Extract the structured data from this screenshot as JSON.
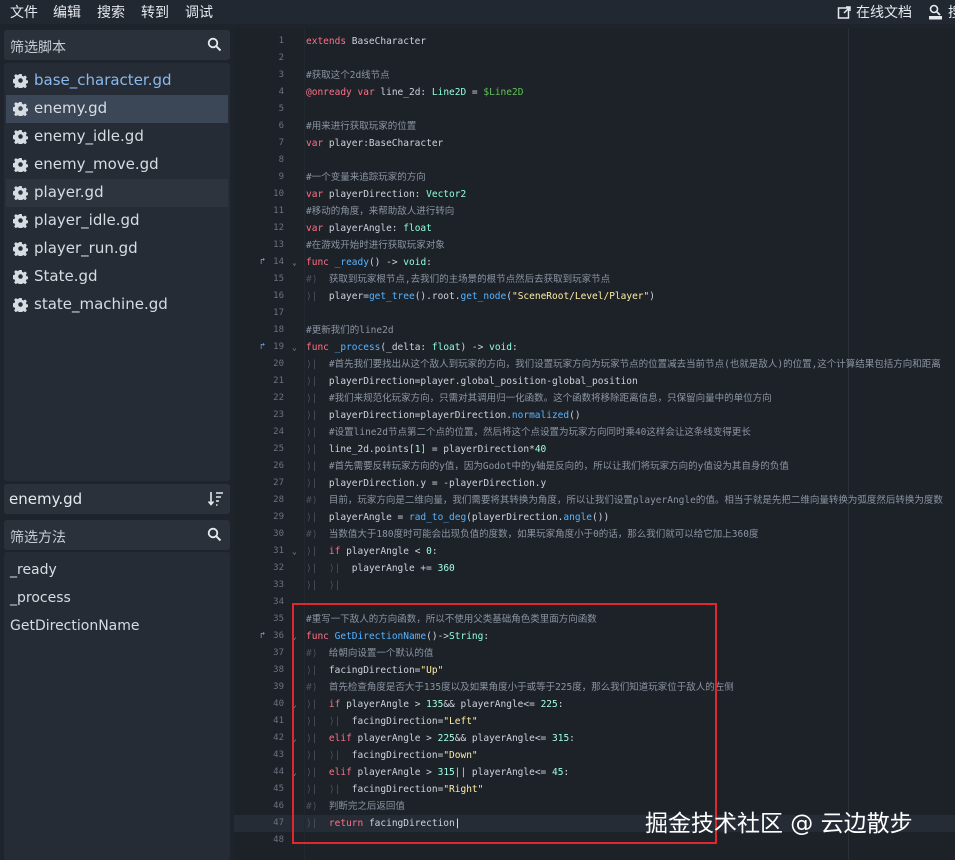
{
  "menu": {
    "file": "文件",
    "edit": "编辑",
    "search": "搜索",
    "goto": "转到",
    "debug": "调试"
  },
  "toolbar": {
    "online_docs": "在线文档",
    "search_help_partial": "搜"
  },
  "scripts": {
    "filter_placeholder": "筛选脚本",
    "items": [
      {
        "label": "base_character.gd",
        "state": "modified"
      },
      {
        "label": "enemy.gd",
        "state": "selected"
      },
      {
        "label": "enemy_idle.gd",
        "state": "normal"
      },
      {
        "label": "enemy_move.gd",
        "state": "normal"
      },
      {
        "label": "player.gd",
        "state": "tinted"
      },
      {
        "label": "player_idle.gd",
        "state": "normal"
      },
      {
        "label": "player_run.gd",
        "state": "normal"
      },
      {
        "label": "State.gd",
        "state": "normal"
      },
      {
        "label": "state_machine.gd",
        "state": "normal"
      }
    ]
  },
  "current_file": "enemy.gd",
  "methods": {
    "filter_placeholder": "筛选方法",
    "items": [
      "_ready",
      "_process",
      "GetDirectionName"
    ]
  },
  "code_lines": [
    {
      "n": "1",
      "html": "<span class=\"kw\">extends</span> BaseCharacter"
    },
    {
      "n": "2",
      "html": ""
    },
    {
      "n": "3",
      "html": "<span class=\"cm\">#获取这个2d线节点</span>"
    },
    {
      "n": "4",
      "html": "<span class=\"kw\">@onready</span> <span class=\"kw\">var</span> line_2d: <span class=\"ty\">Line2D</span> = <span class=\"np\">$Line2D</span>"
    },
    {
      "n": "5",
      "html": ""
    },
    {
      "n": "6",
      "html": "<span class=\"cm\">#用来进行获取玩家的位置</span>"
    },
    {
      "n": "7",
      "html": "<span class=\"kw\">var</span> player:BaseCharacter"
    },
    {
      "n": "8",
      "html": ""
    },
    {
      "n": "9",
      "html": "<span class=\"cm\">#一个变量来追踪玩家的方向</span>"
    },
    {
      "n": "10",
      "html": "<span class=\"kw\">var</span> playerDirection: <span class=\"ty\">Vector2</span>"
    },
    {
      "n": "11",
      "html": "<span class=\"cm\">#移动的角度，来帮助敌人进行转向</span>"
    },
    {
      "n": "12",
      "html": "<span class=\"kw\">var</span> playerAngle: <span class=\"ty\">float</span>"
    },
    {
      "n": "13",
      "html": "<span class=\"cm\">#在游戏开始时进行获取玩家对象</span>"
    },
    {
      "n": "14",
      "fold": true,
      "ov": true,
      "html": "<span class=\"kw\">func</span> <span class=\"fn\">_ready</span>() -> <span class=\"ty\">void</span>:"
    },
    {
      "n": "15",
      "html": "<span class=\"tab\">#⟩</span>  <span class=\"cm\">获取到玩家根节点,去我们的主场景的根节点然后去获取到玩家节点</span>"
    },
    {
      "n": "16",
      "html": "<span class=\"tab\">⟩|</span>  player=<span class=\"fn\">get_tree</span>().root.<span class=\"fn\">get_node</span>(<span class=\"st\">\"SceneRoot/Level/Player\"</span>)"
    },
    {
      "n": "17",
      "html": ""
    },
    {
      "n": "18",
      "html": "<span class=\"cm\">#更新我们的line2d</span>"
    },
    {
      "n": "19",
      "fold": true,
      "ov": true,
      "html": "<span class=\"kw\">func</span> <span class=\"fn\">_process</span>(_delta: <span class=\"ty\">float</span>) -> <span class=\"ty\">void</span>:"
    },
    {
      "n": "20",
      "html": "<span class=\"tab\">⟩|</span>  <span class=\"cm\">#首先我们要找出从这个敌人到玩家的方向，我们设置玩家方向为玩家节点的位置减去当前节点(也就是敌人)的位置,这个计算结果包括方向和距离</span>"
    },
    {
      "n": "21",
      "html": "<span class=\"tab\">⟩|</span>  playerDirection=player.global_position-global_position"
    },
    {
      "n": "22",
      "html": "<span class=\"tab\">⟩|</span>  <span class=\"cm\">#我们来规范化玩家方向，只需对其调用归一化函数。这个函数将移除距离信息，只保留向量中的单位方向</span>"
    },
    {
      "n": "23",
      "html": "<span class=\"tab\">⟩|</span>  playerDirection=playerDirection.<span class=\"fn\">normalized</span>()"
    },
    {
      "n": "24",
      "html": "<span class=\"tab\">⟩|</span>  <span class=\"cm\">#设置line2d节点第二个点的位置，然后将这个点设置为玩家方向同时乘40这样会让这条线变得更长</span>"
    },
    {
      "n": "25",
      "html": "<span class=\"tab\">⟩|</span>  line_2d.points[<span class=\"nm\">1</span>] = playerDirection*<span class=\"nm\">40</span>"
    },
    {
      "n": "26",
      "html": "<span class=\"tab\">⟩|</span>  <span class=\"cm\">#首先需要反转玩家方向的y值，因为Godot中的y轴是反向的，所以让我们将玩家方向的y值设为其自身的负值</span>"
    },
    {
      "n": "27",
      "html": "<span class=\"tab\">⟩|</span>  playerDirection.y = -playerDirection.y"
    },
    {
      "n": "28",
      "html": "<span class=\"tab\">#⟩</span>  <span class=\"cm\">目前，玩家方向是二维向量，我们需要将其转换为角度，所以让我们设置playerAngle的值。相当于就是先把二维向量转换为弧度然后转换为度数</span>"
    },
    {
      "n": "29",
      "html": "<span class=\"tab\">⟩|</span>  playerAngle = <span class=\"fn\">rad_to_deg</span>(playerDirection.<span class=\"fn\">angle</span>())"
    },
    {
      "n": "30",
      "html": "<span class=\"tab\">#⟩</span>  <span class=\"cm\">当数值大于180度时可能会出现负值的度数，如果玩家角度小于0的话，那么我们就可以给它加上360度</span>"
    },
    {
      "n": "31",
      "fold": true,
      "html": "<span class=\"tab\">⟩|</span>  <span class=\"kw\">if</span> playerAngle &lt; <span class=\"nm\">0</span>:"
    },
    {
      "n": "32",
      "html": "<span class=\"tab\">⟩|</span>  <span class=\"tab\">⟩|</span>  playerAngle += <span class=\"nm\">360</span>"
    },
    {
      "n": "33",
      "html": "<span class=\"tab\">⟩|</span>  <span class=\"tab\">⟩|</span>"
    },
    {
      "n": "34",
      "html": ""
    },
    {
      "n": "35",
      "html": "<span class=\"cm\">#重写一下敌人的方向函数，所以不使用父类基础角色类里面方向函数</span>"
    },
    {
      "n": "36",
      "fold": true,
      "ov": true,
      "html": "<span class=\"kw\">func</span> <span class=\"fn\">GetDirectionName</span>()-><span class=\"ty\">String</span>:"
    },
    {
      "n": "37",
      "html": "<span class=\"tab\">#⟩</span>  <span class=\"cm\">给朝向设置一个默认的值</span>"
    },
    {
      "n": "38",
      "html": "<span class=\"tab\">⟩|</span>  facingDirection=<span class=\"st\">\"Up\"</span>"
    },
    {
      "n": "39",
      "html": "<span class=\"tab\">#⟩</span>  <span class=\"cm\">首先检查角度是否大于135度以及如果角度小于或等于225度，那么我们知道玩家位于敌人的左侧</span>"
    },
    {
      "n": "40",
      "fold": true,
      "html": "<span class=\"tab\">⟩|</span>  <span class=\"kw\">if</span> playerAngle &gt; <span class=\"nm\">135</span>&amp;&amp; playerAngle&lt;= <span class=\"nm\">225</span>:"
    },
    {
      "n": "41",
      "html": "<span class=\"tab\">⟩|</span>  <span class=\"tab\">⟩|</span>  facingDirection=<span class=\"st\">\"Left\"</span>"
    },
    {
      "n": "42",
      "fold": true,
      "html": "<span class=\"tab\">⟩|</span>  <span class=\"kw\">elif</span> playerAngle &gt; <span class=\"nm\">225</span>&amp;&amp; playerAngle&lt;= <span class=\"nm\">315</span>:"
    },
    {
      "n": "43",
      "html": "<span class=\"tab\">⟩|</span>  <span class=\"tab\">⟩|</span>  facingDirection=<span class=\"st\">\"Down\"</span>"
    },
    {
      "n": "44",
      "fold": true,
      "html": "<span class=\"tab\">⟩|</span>  <span class=\"kw\">elif</span> playerAngle &gt; <span class=\"nm\">315</span>|| playerAngle&lt;= <span class=\"nm\">45</span>:"
    },
    {
      "n": "45",
      "html": "<span class=\"tab\">⟩|</span>  <span class=\"tab\">⟩|</span>  facingDirection=<span class=\"st\">\"Right\"</span>"
    },
    {
      "n": "46",
      "html": "<span class=\"tab\">#⟩</span>  <span class=\"cm\">判断完之后返回值</span>"
    },
    {
      "n": "47",
      "html": "<span class=\"tab\">⟩|</span>  <span class=\"kw\">return</span> facingDirection<span style=\"color:#ffffff\">|</span>"
    },
    {
      "n": "48",
      "html": ""
    }
  ],
  "watermark": "掘金技术社区 @ 云边散步",
  "colors": {
    "accent": "#8ab9ec",
    "selection": "#3b4656",
    "highlight_border": "#e0262e"
  }
}
